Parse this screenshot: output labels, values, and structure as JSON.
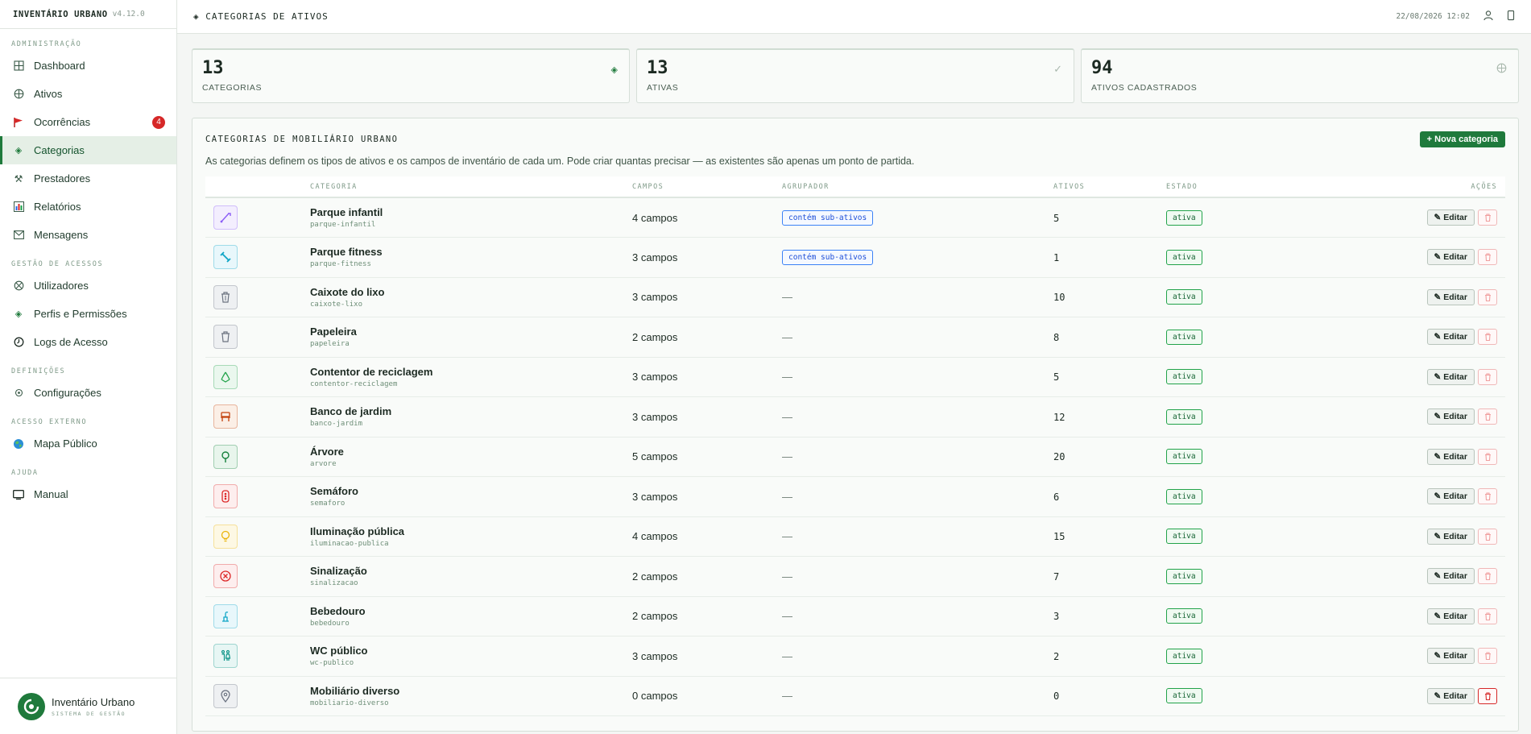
{
  "app": {
    "name": "INVENTÁRIO URBANO",
    "version": "v4.12.0"
  },
  "sidebar": {
    "sections": [
      {
        "title": "ADMINISTRAÇÃO",
        "items": [
          {
            "label": "Dashboard",
            "icon": "grid-icon"
          },
          {
            "label": "Ativos",
            "icon": "globe-icon"
          },
          {
            "label": "Ocorrências",
            "icon": "flag-icon",
            "badge": "4"
          },
          {
            "label": "Categorias",
            "icon": "diamond-icon",
            "active": true
          },
          {
            "label": "Prestadores",
            "icon": "tools-icon"
          },
          {
            "label": "Relatórios",
            "icon": "chart-icon"
          },
          {
            "label": "Mensagens",
            "icon": "mail-icon"
          }
        ]
      },
      {
        "title": "GESTÃO DE ACESSOS",
        "items": [
          {
            "label": "Utilizadores",
            "icon": "users-icon"
          },
          {
            "label": "Perfis e Permissões",
            "icon": "diamond-icon"
          },
          {
            "label": "Logs de Acesso",
            "icon": "clock-icon"
          }
        ]
      },
      {
        "title": "DEFINIÇÕES",
        "items": [
          {
            "label": "Configurações",
            "icon": "gear-icon"
          }
        ]
      },
      {
        "title": "ACESSO EXTERNO",
        "items": [
          {
            "label": "Mapa Público",
            "icon": "world-icon"
          }
        ]
      },
      {
        "title": "AJUDA",
        "items": [
          {
            "label": "Manual",
            "icon": "monitor-icon"
          }
        ]
      }
    ],
    "footer": {
      "title": "Inventário Urbano",
      "subtitle": "SISTEMA DE GESTÃO"
    }
  },
  "topbar": {
    "title": "CATEGORIAS DE ATIVOS",
    "datetime": "22/08/2026 12:02"
  },
  "stats": [
    {
      "value": "13",
      "label": "CATEGORIAS",
      "icon": "diamond-icon"
    },
    {
      "value": "13",
      "label": "ATIVAS",
      "icon": "check-icon"
    },
    {
      "value": "94",
      "label": "ATIVOS CADASTRADOS",
      "icon": "globe-icon"
    }
  ],
  "panel": {
    "title": "CATEGORIAS DE MOBILIÁRIO URBANO",
    "new_button": "+ Nova categoria",
    "description": "As categorias definem os tipos de ativos e os campos de inventário de cada um. Pode criar quantas precisar — as existentes são apenas um ponto de partida.",
    "columns": [
      "",
      "CATEGORIA",
      "CAMPOS",
      "AGRUPADOR",
      "ATIVOS",
      "ESTADO",
      "AÇÕES"
    ],
    "edit_label": "✎ Editar",
    "rows": [
      {
        "name": "Parque infantil",
        "slug": "parque-infantil",
        "campos": "4 campos",
        "agrupador": "contém sub-ativos",
        "ativos": "5",
        "estado": "ativa",
        "icon": "slide-icon",
        "color": "#8b5cf6",
        "bg": "#f3eefe"
      },
      {
        "name": "Parque fitness",
        "slug": "parque-fitness",
        "campos": "3 campos",
        "agrupador": "contém sub-ativos",
        "ativos": "1",
        "estado": "ativa",
        "icon": "dumbbell-icon",
        "color": "#0ea5c6",
        "bg": "#e8f7fb"
      },
      {
        "name": "Caixote do lixo",
        "slug": "caixote-lixo",
        "campos": "3 campos",
        "agrupador": "—",
        "ativos": "10",
        "estado": "ativa",
        "icon": "trash-icon",
        "color": "#6b7280",
        "bg": "#eef0f2"
      },
      {
        "name": "Papeleira",
        "slug": "papeleira",
        "campos": "2 campos",
        "agrupador": "—",
        "ativos": "8",
        "estado": "ativa",
        "icon": "bin-icon",
        "color": "#6b7280",
        "bg": "#eef0f2"
      },
      {
        "name": "Contentor de reciclagem",
        "slug": "contentor-reciclagem",
        "campos": "3 campos",
        "agrupador": "—",
        "ativos": "5",
        "estado": "ativa",
        "icon": "recycle-icon",
        "color": "#22a34a",
        "bg": "#eaf7ee"
      },
      {
        "name": "Banco de jardim",
        "slug": "banco-jardim",
        "campos": "3 campos",
        "agrupador": "—",
        "ativos": "12",
        "estado": "ativa",
        "icon": "bench-icon",
        "color": "#c2410c",
        "bg": "#fbefe6"
      },
      {
        "name": "Árvore",
        "slug": "arvore",
        "campos": "5 campos",
        "agrupador": "—",
        "ativos": "20",
        "estado": "ativa",
        "icon": "tree-icon",
        "color": "#16803c",
        "bg": "#e8f5ec"
      },
      {
        "name": "Semáforo",
        "slug": "semaforo",
        "campos": "3 campos",
        "agrupador": "—",
        "ativos": "6",
        "estado": "ativa",
        "icon": "traffic-light-icon",
        "color": "#dc2626",
        "bg": "#fdeeee"
      },
      {
        "name": "Iluminação pública",
        "slug": "iluminacao-publica",
        "campos": "4 campos",
        "agrupador": "—",
        "ativos": "15",
        "estado": "ativa",
        "icon": "bulb-icon",
        "color": "#eab308",
        "bg": "#fdf8e4"
      },
      {
        "name": "Sinalização",
        "slug": "sinalizacao",
        "campos": "2 campos",
        "agrupador": "—",
        "ativos": "7",
        "estado": "ativa",
        "icon": "sign-icon",
        "color": "#dc2626",
        "bg": "#fdeeee"
      },
      {
        "name": "Bebedouro",
        "slug": "bebedouro",
        "campos": "2 campos",
        "agrupador": "—",
        "ativos": "3",
        "estado": "ativa",
        "icon": "fountain-icon",
        "color": "#0ea5c6",
        "bg": "#e8f7fb"
      },
      {
        "name": "WC público",
        "slug": "wc-publico",
        "campos": "3 campos",
        "agrupador": "—",
        "ativos": "2",
        "estado": "ativa",
        "icon": "wc-icon",
        "color": "#0d9488",
        "bg": "#e7f6f4"
      },
      {
        "name": "Mobiliário diverso",
        "slug": "mobiliario-diverso",
        "campos": "0 campos",
        "agrupador": "—",
        "ativos": "0",
        "estado": "ativa",
        "icon": "pin-icon",
        "color": "#6b7280",
        "bg": "#eef0f2",
        "delete_enabled": true
      }
    ]
  }
}
